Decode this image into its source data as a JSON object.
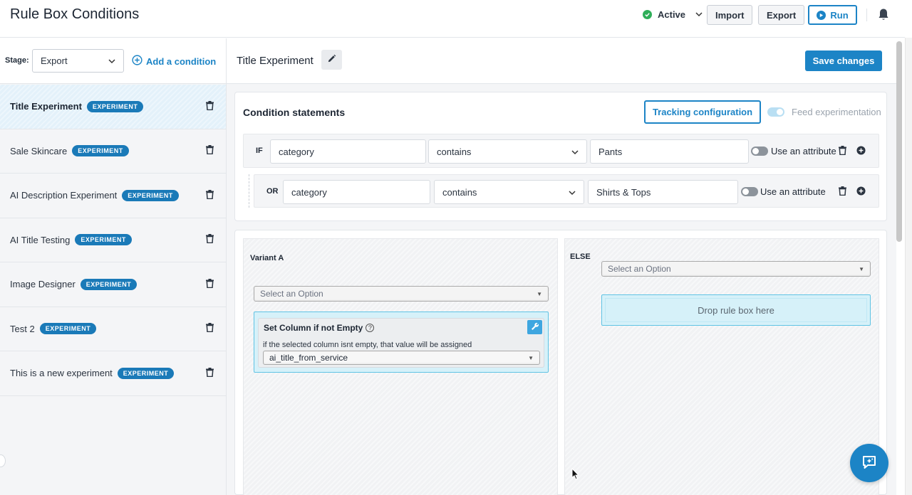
{
  "header": {
    "title": "Rule Box Conditions",
    "status_label": "Active",
    "import_label": "Import",
    "export_label": "Export",
    "run_label": "Run"
  },
  "sidebar": {
    "stage_label": "Stage:",
    "stage_value": "Export",
    "add_condition_label": "Add a condition",
    "items": [
      {
        "name": "Title Experiment",
        "badge": "EXPERIMENT"
      },
      {
        "name": "Sale Skincare",
        "badge": "EXPERIMENT"
      },
      {
        "name": "AI Description Experiment",
        "badge": "EXPERIMENT"
      },
      {
        "name": "AI Title Testing",
        "badge": "EXPERIMENT"
      },
      {
        "name": "Image Designer",
        "badge": "EXPERIMENT"
      },
      {
        "name": "Test 2",
        "badge": "EXPERIMENT"
      },
      {
        "name": "This is a new experiment",
        "badge": "EXPERIMENT"
      }
    ]
  },
  "main": {
    "rule_title": "Title Experiment",
    "save_label": "Save changes",
    "conditions": {
      "title": "Condition statements",
      "tracking_label": "Tracking configuration",
      "feed_label": "Feed experimentation",
      "rows": [
        {
          "operator": "IF",
          "field": "category",
          "comparator": "contains",
          "value": "Pants",
          "attr_label": "Use an attribute"
        },
        {
          "operator": "OR",
          "field": "category",
          "comparator": "contains",
          "value": "Shirts & Tops",
          "attr_label": "Use an attribute"
        }
      ]
    },
    "variants": {
      "variant_a_label": "Variant A",
      "variant_a_select": "Select an Option",
      "rulebox_title": "Set Column if not Empty",
      "rulebox_help": "?",
      "rulebox_desc": "if the selected column isnt empty, that value will be assigned",
      "rulebox_select": "ai_title_from_service",
      "else_label": "ELSE",
      "else_select": "Select an Option",
      "drop_label": "Drop rule box here"
    }
  },
  "colors": {
    "primary": "#1c84c6",
    "badge": "#1a7ab8",
    "status_active": "#2fae59",
    "drop_zone": "#d6f1f9"
  }
}
